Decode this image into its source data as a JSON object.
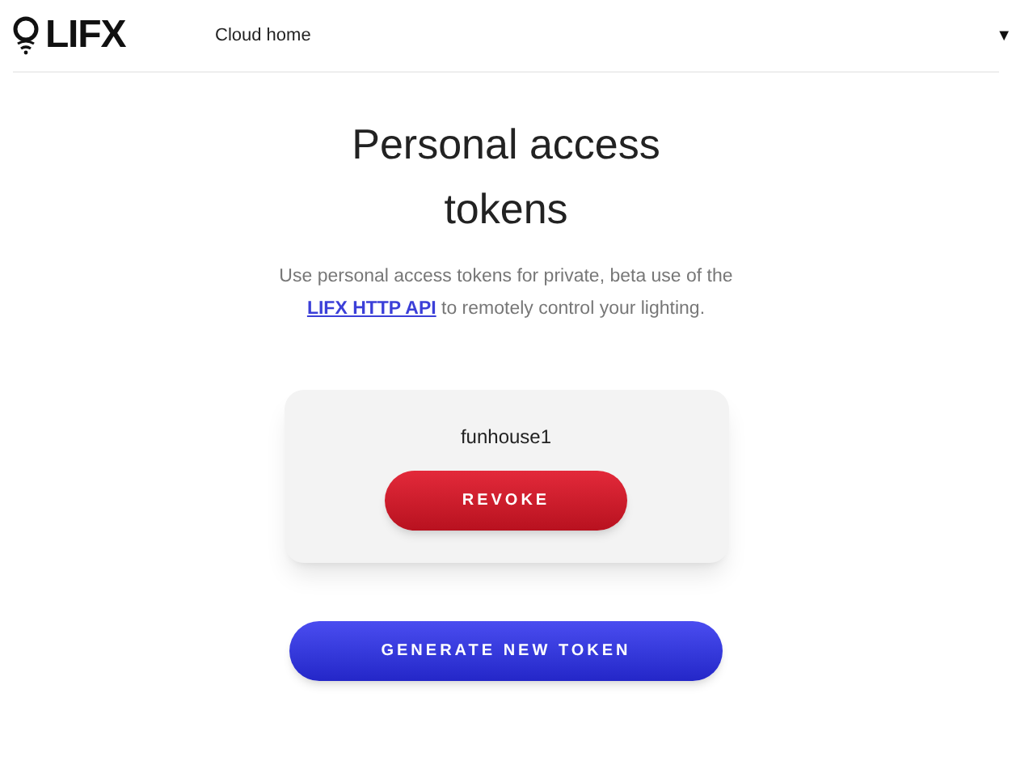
{
  "header": {
    "logo": "LIFX",
    "nav_link": "Cloud home",
    "menu_caret": "▼"
  },
  "page": {
    "title": "Personal access tokens",
    "description": {
      "before": "Use personal access tokens for private, beta use of the ",
      "link": "LIFX HTTP API",
      "after": " to remotely control your lighting."
    }
  },
  "tokens": [
    {
      "name": "funhouse1",
      "button": "REVOKE"
    }
  ],
  "generate_button": "GENERATE NEW TOKEN"
}
